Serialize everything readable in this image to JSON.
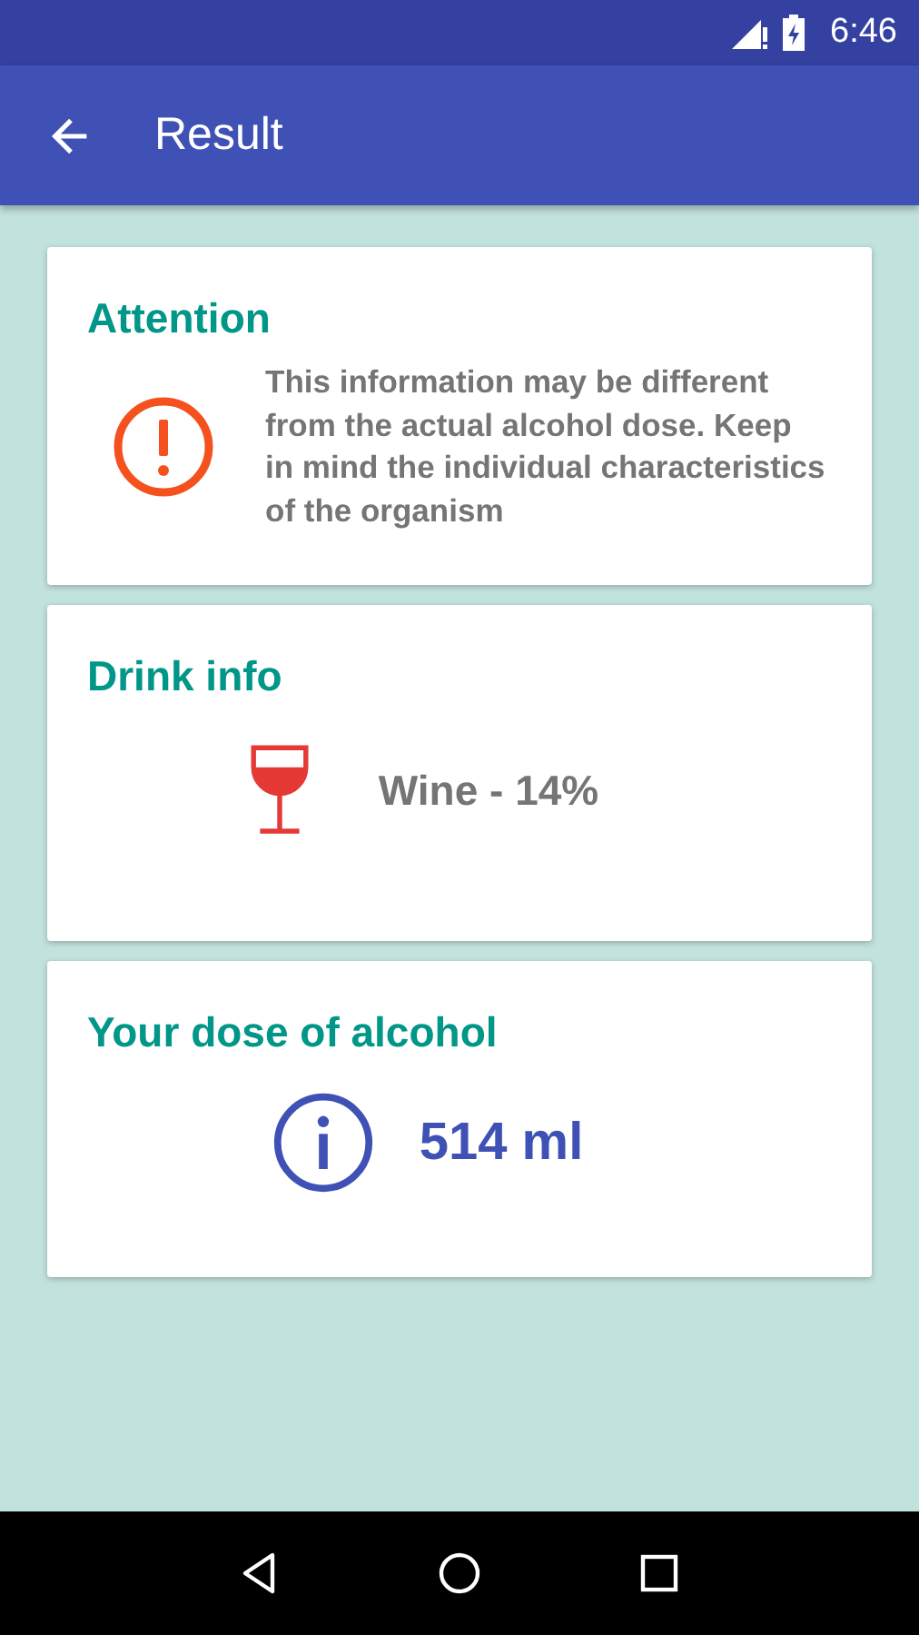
{
  "status_bar": {
    "time": "6:46"
  },
  "toolbar": {
    "title": "Result"
  },
  "cards": [
    {
      "kind": "warning",
      "title": "Attention",
      "text": "This information may be different from the actual alcohol dose. Keep in mind the individual characteristics of the organism"
    },
    {
      "kind": "drink",
      "title": "Drink info",
      "text": "Wine - 14%"
    },
    {
      "kind": "dose",
      "title": "Your dose of alcohol",
      "text": "514 ml"
    }
  ]
}
